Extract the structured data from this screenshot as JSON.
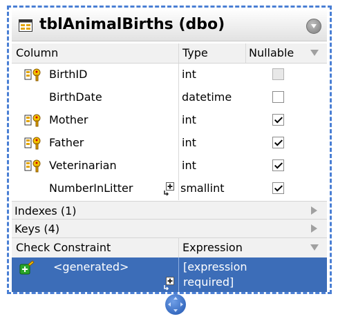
{
  "table": {
    "title": "tblAnimalBirths (dbo)",
    "icon": "table-icon"
  },
  "columns_header": {
    "column": "Column",
    "type": "Type",
    "nullable": "Nullable"
  },
  "columns": [
    {
      "name": "BirthID",
      "type": "int",
      "key": true,
      "nullable": false,
      "nullable_disabled": true
    },
    {
      "name": "BirthDate",
      "type": "datetime",
      "key": false,
      "nullable": false,
      "nullable_disabled": false
    },
    {
      "name": "Mother",
      "type": "int",
      "key": true,
      "nullable": true,
      "nullable_disabled": false
    },
    {
      "name": "Father",
      "type": "int",
      "key": true,
      "nullable": true,
      "nullable_disabled": false
    },
    {
      "name": "Veterinarian",
      "type": "int",
      "key": true,
      "nullable": true,
      "nullable_disabled": false
    },
    {
      "name": "NumberInLitter",
      "type": "smallint",
      "key": false,
      "nullable": true,
      "nullable_disabled": false
    }
  ],
  "sections": {
    "indexes": "Indexes (1)",
    "keys": "Keys (4)"
  },
  "check_constraint": {
    "header_left": "Check Constraint",
    "header_right": "Expression",
    "name": "<generated>",
    "expression_line1": "[expression",
    "expression_line2": "required]"
  },
  "colors": {
    "border_accent": "#4a7fd4",
    "selection": "#3c6db8",
    "key_icon": "#e2a400",
    "constraint_icon": "#2aa52a"
  }
}
